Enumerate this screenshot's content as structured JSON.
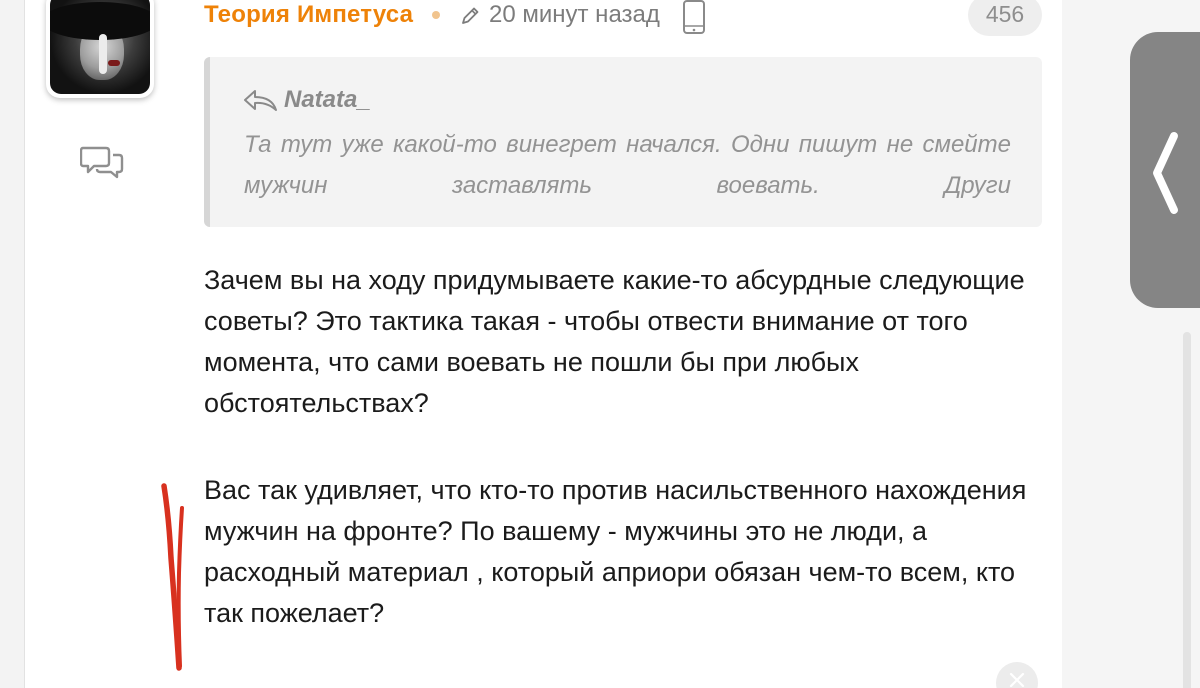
{
  "post": {
    "author": "Теория Импетуса",
    "timestamp": "20 минут назад",
    "counter": "456"
  },
  "icons": {
    "avatar": "avatar-photo",
    "comment": "comment-bubbles-icon",
    "edit": "pencil-icon",
    "device": "mobile-phone-icon",
    "reply": "reply-arrow-icon",
    "close": "close-icon",
    "side_arrow": "chevron-left-icon"
  },
  "quote": {
    "author": "Natata_",
    "text": "Та тут уже какой-то винегрет начался. Одни пишут не смейте мужчин заставлять воевать. Други"
  },
  "body": {
    "paragraph_1": "Зачем вы на ходу придумываете какие-то абсурдные следующие советы? Это тактика такая - чтобы отвести внимание от того момента, что сами воевать не пошли бы при любых обстоятельствах?",
    "paragraph_2": "Вас так удивляет, что кто-то против насильственного нахождения мужчин на фронте? По вашему - мужчины это не люди, а расходный материал , который априори обязан чем-то всем, кто так пожелает?"
  },
  "colors": {
    "author": "#ee8208",
    "body_text": "#1b1b1b",
    "quote_text": "#939393",
    "annotation_mark": "#d8311f"
  }
}
